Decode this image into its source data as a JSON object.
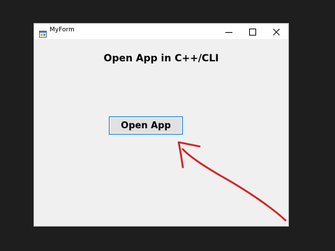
{
  "window": {
    "title": "MyForm",
    "icon": "winforms-app-icon",
    "controls": {
      "minimize": "minimize-icon",
      "maximize": "maximize-icon",
      "close": "close-icon"
    }
  },
  "form": {
    "heading": "Open App in C++/CLI",
    "open_button_label": "Open App"
  },
  "colors": {
    "focus_border": "#0078d7",
    "annotation_arrow": "#d42020",
    "form_background": "#f0f0f0",
    "outer_background": "#1e1e1e"
  }
}
